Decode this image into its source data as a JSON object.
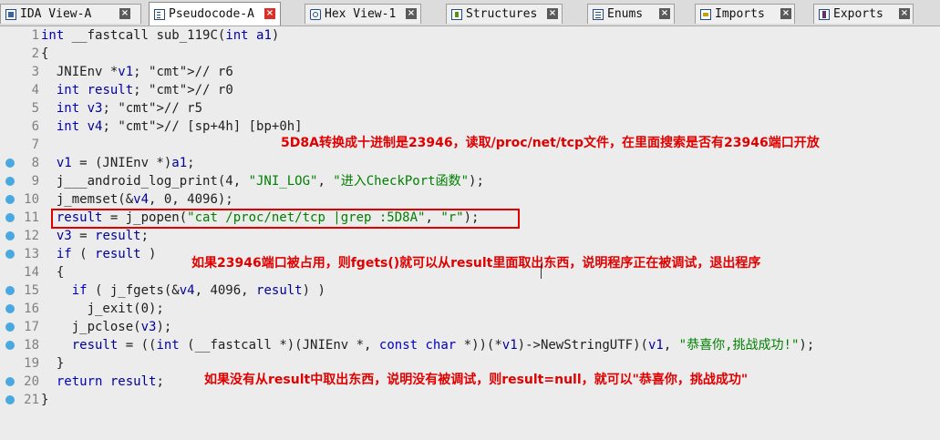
{
  "tabs": [
    {
      "label": "IDA View-A",
      "icon": "ida-view-icon",
      "active": false
    },
    {
      "label": "Pseudocode-A",
      "icon": "pseudocode-icon",
      "active": true
    },
    {
      "label": "Hex View-1",
      "icon": "hex-view-icon",
      "active": false
    },
    {
      "label": "Structures",
      "icon": "structures-icon",
      "active": false
    },
    {
      "label": "Enums",
      "icon": "enums-icon",
      "active": false
    },
    {
      "label": "Imports",
      "icon": "imports-icon",
      "active": false
    },
    {
      "label": "Exports",
      "icon": "exports-icon",
      "active": false
    }
  ],
  "close_glyph": "×",
  "code_lines": [
    {
      "n": "1",
      "text": "int __fastcall sub_119C(int a1)",
      "breakpoint": false
    },
    {
      "n": "2",
      "text": "{",
      "breakpoint": false
    },
    {
      "n": "3",
      "text": "  JNIEnv *v1; // r6",
      "breakpoint": false
    },
    {
      "n": "4",
      "text": "  int result; // r0",
      "breakpoint": false
    },
    {
      "n": "5",
      "text": "  int v3; // r5",
      "breakpoint": false
    },
    {
      "n": "6",
      "text": "  int v4; // [sp+4h] [bp+0h]",
      "breakpoint": false
    },
    {
      "n": "7",
      "text": "",
      "breakpoint": false
    },
    {
      "n": "8",
      "text": "  v1 = (JNIEnv *)a1;",
      "breakpoint": true
    },
    {
      "n": "9",
      "text": "  j___android_log_print(4, \"JNI_LOG\", \"进入CheckPort函数\");",
      "breakpoint": true
    },
    {
      "n": "10",
      "text": "  j_memset(&v4, 0, 4096);",
      "breakpoint": true
    },
    {
      "n": "11",
      "text": "  result = j_popen(\"cat /proc/net/tcp |grep :5D8A\", \"r\");",
      "breakpoint": true
    },
    {
      "n": "12",
      "text": "  v3 = result;",
      "breakpoint": true
    },
    {
      "n": "13",
      "text": "  if ( result )",
      "breakpoint": true
    },
    {
      "n": "14",
      "text": "  {",
      "breakpoint": false
    },
    {
      "n": "15",
      "text": "    if ( j_fgets(&v4, 4096, result) )",
      "breakpoint": true
    },
    {
      "n": "16",
      "text": "      j_exit(0);",
      "breakpoint": true
    },
    {
      "n": "17",
      "text": "    j_pclose(v3);",
      "breakpoint": true
    },
    {
      "n": "18",
      "text": "    result = ((int (__fastcall *)(JNIEnv *, const char *))(*v1)->NewStringUTF)(v1, \"恭喜你,挑战成功!\");",
      "breakpoint": true
    },
    {
      "n": "19",
      "text": "  }",
      "breakpoint": false
    },
    {
      "n": "20",
      "text": "  return result;",
      "breakpoint": true
    },
    {
      "n": "21",
      "text": "}",
      "breakpoint": true
    }
  ],
  "annotations": [
    "5D8A转换成十进制是23946，读取/proc/net/tcp文件，在里面搜索是否有23946端口开放",
    "如果23946端口被占用，则fgets()就可以从result里面取出东西，说明程序正在被调试，退出程序",
    "如果没有从result中取出东西，说明没有被调试，则result=null，就可以\"恭喜你，挑战成功\""
  ],
  "colors": {
    "accent_red": "#e00000",
    "breakpoint_dot": "#4aa8e0",
    "line_number": "#808080"
  }
}
